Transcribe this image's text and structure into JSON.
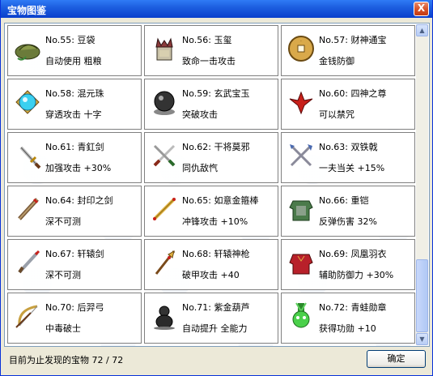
{
  "window": {
    "title": "宝物图鉴",
    "close_label": "X"
  },
  "items": [
    {
      "name": "No.55: 豆袋",
      "desc": "自动使用 粗粮",
      "icon": "bean-bag-icon"
    },
    {
      "name": "No.56: 玉玺",
      "desc": "致命一击攻击",
      "icon": "jade-seal-icon"
    },
    {
      "name": "No.57: 财神通宝",
      "desc": "金钱防御",
      "icon": "gold-coin-icon"
    },
    {
      "name": "No.58: 混元珠",
      "desc": "穿透攻击 十字",
      "icon": "crystal-orb-icon"
    },
    {
      "name": "No.59: 玄武宝玉",
      "desc": "突破攻击",
      "icon": "black-orb-icon"
    },
    {
      "name": "No.60: 四神之尊",
      "desc": "可以禁咒",
      "icon": "red-phoenix-icon"
    },
    {
      "name": "No.61: 青釭剑",
      "desc": "加强攻击 +30%",
      "icon": "sword-icon"
    },
    {
      "name": "No.62: 干将莫邪",
      "desc": "同仇敌忾",
      "icon": "twin-swords-icon"
    },
    {
      "name": "No.63: 双铁戟",
      "desc": "一夫当关 +15%",
      "icon": "twin-halberds-icon"
    },
    {
      "name": "No.64: 封印之剑",
      "desc": "深不可测",
      "icon": "sealed-sword-icon"
    },
    {
      "name": "No.65: 如意金箍棒",
      "desc": "冲锋攻击 +10%",
      "icon": "golden-staff-icon"
    },
    {
      "name": "No.66: 重铠",
      "desc": "反弹伤害 32%",
      "icon": "heavy-armor-icon"
    },
    {
      "name": "No.67: 轩辕剑",
      "desc": "深不可测",
      "icon": "xuanyuan-sword-icon"
    },
    {
      "name": "No.68: 轩辕神枪",
      "desc": "破甲攻击 +40",
      "icon": "spear-icon"
    },
    {
      "name": "No.69: 凤凰羽衣",
      "desc": "辅助防御力 +30%",
      "icon": "phoenix-robe-icon"
    },
    {
      "name": "No.70: 后羿弓",
      "desc": "中毒破士",
      "icon": "bow-icon"
    },
    {
      "name": "No.71: 紫金葫芦",
      "desc": "自动提升 全能力",
      "icon": "gourd-icon"
    },
    {
      "name": "No.72: 青蛙勋章",
      "desc": "获得功勋 +10",
      "icon": "frog-medal-icon"
    }
  ],
  "status": {
    "text": "目前为止发现的宝物 72 / 72"
  },
  "buttons": {
    "ok_label": "确定"
  }
}
